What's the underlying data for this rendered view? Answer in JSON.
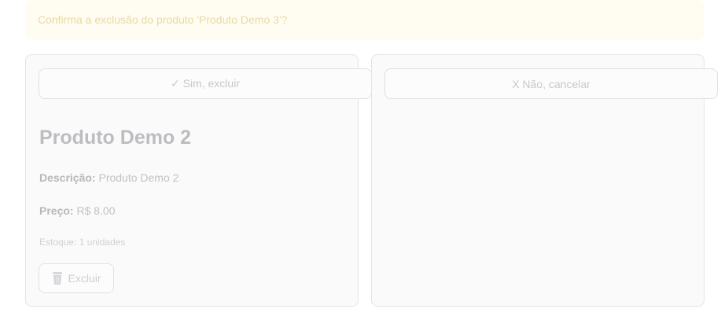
{
  "alert": {
    "message": "Confirma a exclusão do produto 'Produto Demo 3'?"
  },
  "confirm": {
    "yes_label": "✓ Sim, excluir",
    "no_label": "X Não, cancelar"
  },
  "product": {
    "name": "Produto Demo 2",
    "description_label": "Descrição:",
    "description_value": "Produto Demo 2",
    "price_label": "Preço:",
    "price_value": "R$ 8.00",
    "stock_text": "Estoque: 1 unidades",
    "delete_label": "Excluir",
    "delete_icon": "trash-icon"
  }
}
